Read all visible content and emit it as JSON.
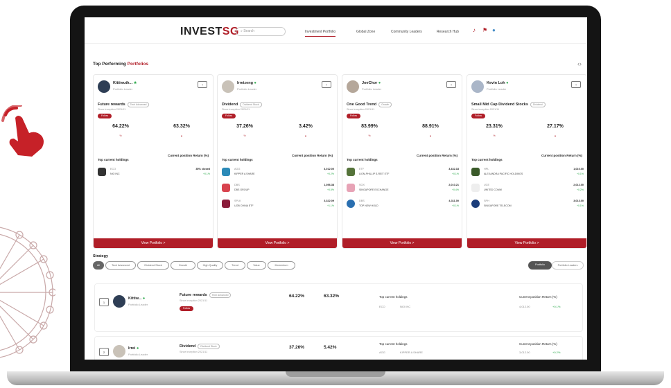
{
  "nav": {
    "brand_prefix": "INVEST",
    "brand_suffix": "SG",
    "search_placeholder": "Search",
    "links": [
      "Investment Portfolio",
      "Global Zone",
      "Community Leaders",
      "Research Hub"
    ]
  },
  "top": {
    "heading": "Top Performing",
    "heading_red": "Portfolios",
    "cards": [
      {
        "user": "Kittiwuth...",
        "sub": "Portfolio Leader",
        "portfolio": "Future rewards",
        "tag": "Tech Advanced",
        "date": "Since inception 2021/11",
        "badge": "Follow",
        "r1": "64.22%",
        "r2": "63.32%",
        "holdings_title": "Top current holdings",
        "cp_title": "Current position Return (%)",
        "holdings": [
          {
            "tick": "ECO",
            "name": "NIO INC",
            "price": "35% closed",
            "pct": "+0.1%"
          }
        ]
      },
      {
        "user": "Irreizeng",
        "sub": "Portfolio Leader",
        "portfolio": "Dividend",
        "tag": "Dividend Stock",
        "date": "Since inception 2021/11",
        "badge": "Follow",
        "r1": "37.26%",
        "r2": "3.42%",
        "holdings_title": "Top current holdings",
        "cp_title": "Current position Return (%)",
        "holdings": [
          {
            "tick": "AGG",
            "name": "KIPPER A SHARE",
            "price": "4,012.00",
            "pct": "+0.2%"
          },
          {
            "tick": "DBS",
            "name": "DBS GROUP",
            "price": "1,056.38",
            "pct": "+0.5%"
          },
          {
            "tick": "SPLK",
            "name": "UOB CHINA ETF",
            "price": "3,322.09",
            "pct": "+1.1%"
          }
        ]
      },
      {
        "user": "JoeChor",
        "sub": "Portfolio Leader",
        "portfolio": "One Good Trend",
        "tag": "Growth",
        "date": "Since inception 2021/11",
        "badge": "Follow",
        "r1": "83.99%",
        "r2": "88.91%",
        "holdings_title": "Top current holdings",
        "cp_title": "Current position Return (%)",
        "holdings": [
          {
            "tick": "ETF",
            "name": "LION-PHILLIP S-REIT ETF",
            "price": "3,432.18",
            "pct": "+0.1%"
          },
          {
            "tick": "SGX",
            "name": "SINGAPORE EXCHANGE",
            "price": "2,010.21",
            "pct": "+0.4%"
          },
          {
            "tick": "DBS",
            "name": "TOP NEW HOLD",
            "price": "4,311.00",
            "pct": "+0.1%"
          }
        ]
      },
      {
        "user": "Kevin Loh",
        "sub": "Portfolio Leader",
        "portfolio": "Small Mid Cap Dividend Stocks",
        "tag": "Dividend",
        "date": "Since inception 2021/11",
        "badge": "Follow",
        "r1": "23.31%",
        "r2": "27.17%",
        "holdings_title": "Top current holdings",
        "cp_title": "Current position Return (%)",
        "holdings": [
          {
            "tick": "HPL",
            "name": "ALEXANDRA PACIFIC HOLDINGS",
            "price": "1,010.00",
            "pct": "+0.1%"
          },
          {
            "tick": "UCE",
            "name": "UNITED COMM",
            "price": "2,012.00",
            "pct": "+0.2%"
          },
          {
            "tick": "SPH",
            "name": "SINGAPORE TELECOM",
            "price": "3,013.00",
            "pct": "+0.1%"
          }
        ]
      }
    ],
    "view_label": "View Portfolio >"
  },
  "strategy": {
    "heading": "Strategy",
    "chips": [
      "All",
      "Tech Advanced",
      "Dividend Stock",
      "Growth",
      "High Quality",
      "Trend",
      "Value",
      "Momentum"
    ],
    "toggle": [
      "Portfolio",
      "Portfolio Leaders"
    ],
    "rows": [
      {
        "rank": "1",
        "user": "Kittiw...",
        "sub": "Portfolio Leader",
        "portfolio": "Future rewards",
        "tag": "Tech Advanced",
        "date": "Since inception 2021/11",
        "badge": "Follow",
        "r1": "64.22%",
        "r2": "63.32%",
        "th": "Top current holdings",
        "tick": "ECO",
        "hname": "NIO INC",
        "cp": "Current position Return (%)",
        "cpv": "4,012.00",
        "cpp": "+0.1%"
      },
      {
        "rank": "2",
        "user": "Irrei",
        "sub": "Portfolio Leader",
        "portfolio": "Dividend",
        "tag": "Dividend Stock",
        "date": "Since inception 2021/11",
        "badge": "Follow",
        "r1": "37.26%",
        "r2": "5.42%",
        "th": "Top current holdings",
        "tick": "AGG",
        "hname": "KIPPER A SHARE",
        "cp": "Current position Return (%)",
        "cpv": "3,012.00",
        "cpp": "+0.2%"
      }
    ]
  }
}
